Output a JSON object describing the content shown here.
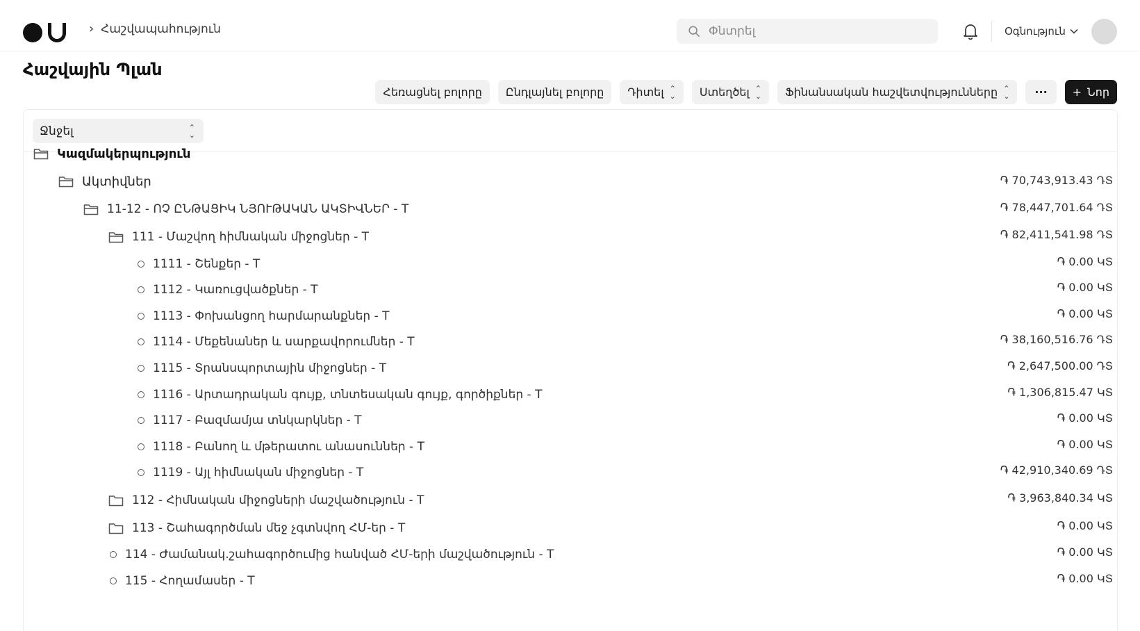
{
  "nav": {
    "breadcrumb": "Հաշվապահություն",
    "search_placeholder": "Փնտրել",
    "help_label": "Օգնություն"
  },
  "header": {
    "title": "Հաշվային Պլան",
    "buttons": {
      "collapse_all": "Հեռացնել բոլորը",
      "expand_all": "Ընդլայնել բոլորը",
      "view": "Դիտել",
      "create": "Ստեղծել",
      "financial_reports": "Ֆինանսական հաշվետվությունները",
      "more": "···",
      "new": "Նոր"
    }
  },
  "filter": {
    "group_by_value": "Ջնջել"
  },
  "tree": [
    {
      "level": 0,
      "kind": "folder",
      "label": "Կազմակերպություն",
      "amount": ""
    },
    {
      "level": 1,
      "kind": "folder",
      "label": "Ակտիվներ",
      "amount": "֏ 70,743,913.43 ԴՏ"
    },
    {
      "level": 2,
      "kind": "folder",
      "label": "11-12 - ՈՉ ԸՆԹԱՑԻԿ ՆՅՈՒԹԱԿԱՆ ԱԿՏԻՎՆԵՐ - T",
      "amount": "֏ 78,447,701.64 ԴՏ"
    },
    {
      "level": 3,
      "kind": "folder",
      "label": "111 - Մաշվող հիմնական միջոցներ - T",
      "amount": "֏ 82,411,541.98 ԴՏ"
    },
    {
      "level": 4,
      "kind": "leaf",
      "label": "1111 - Շենքեր - T",
      "amount": "֏ 0.00 ԿՏ"
    },
    {
      "level": 4,
      "kind": "leaf",
      "label": "1112 - Կառուցվածքներ - T",
      "amount": "֏ 0.00 ԿՏ"
    },
    {
      "level": 4,
      "kind": "leaf",
      "label": "1113 - Փոխանցող հարմարանքներ - T",
      "amount": "֏ 0.00 ԿՏ"
    },
    {
      "level": 4,
      "kind": "leaf",
      "label": "1114 - Մեքենաներ և սարքավորումներ - T",
      "amount": "֏ 38,160,516.76 ԴՏ"
    },
    {
      "level": 4,
      "kind": "leaf",
      "label": "1115 - Տրանսպորտային միջոցներ - T",
      "amount": "֏ 2,647,500.00 ԴՏ"
    },
    {
      "level": 4,
      "kind": "leaf",
      "label": "1116 - Արտադրական գույք, տնտեսական գույք, գործիքներ - T",
      "amount": "֏ 1,306,815.47 ԿՏ"
    },
    {
      "level": 4,
      "kind": "leaf",
      "label": "1117 - Բազմամյա տնկարկներ - T",
      "amount": "֏ 0.00 ԿՏ"
    },
    {
      "level": 4,
      "kind": "leaf",
      "label": "1118 - Բանող և մթերատու անասուններ - T",
      "amount": "֏ 0.00 ԿՏ"
    },
    {
      "level": 4,
      "kind": "leaf",
      "label": "1119 - Այլ հիմնական միջոցներ - T",
      "amount": "֏ 42,910,340.69 ԴՏ"
    },
    {
      "level": 3,
      "kind": "folder",
      "label": "112 - Հիմնական միջոցների մաշվածություն - T",
      "amount": "֏ 3,963,840.34 ԿՏ"
    },
    {
      "level": 3,
      "kind": "folder",
      "label": "113 - Շահագործման մեջ չգտնվող ՀՄ-եր - T",
      "amount": "֏ 0.00 ԿՏ"
    },
    {
      "level": 3,
      "kind": "leaf",
      "label": "114 - Ժամանակ.շահագործումից հանված ՀՄ-երի մաշվածություն - T",
      "amount": "֏ 0.00 ԿՏ"
    },
    {
      "level": 3,
      "kind": "leaf",
      "label": "115 - Հողամասեր - T",
      "amount": "֏ 0.00 ԿՏ"
    }
  ]
}
